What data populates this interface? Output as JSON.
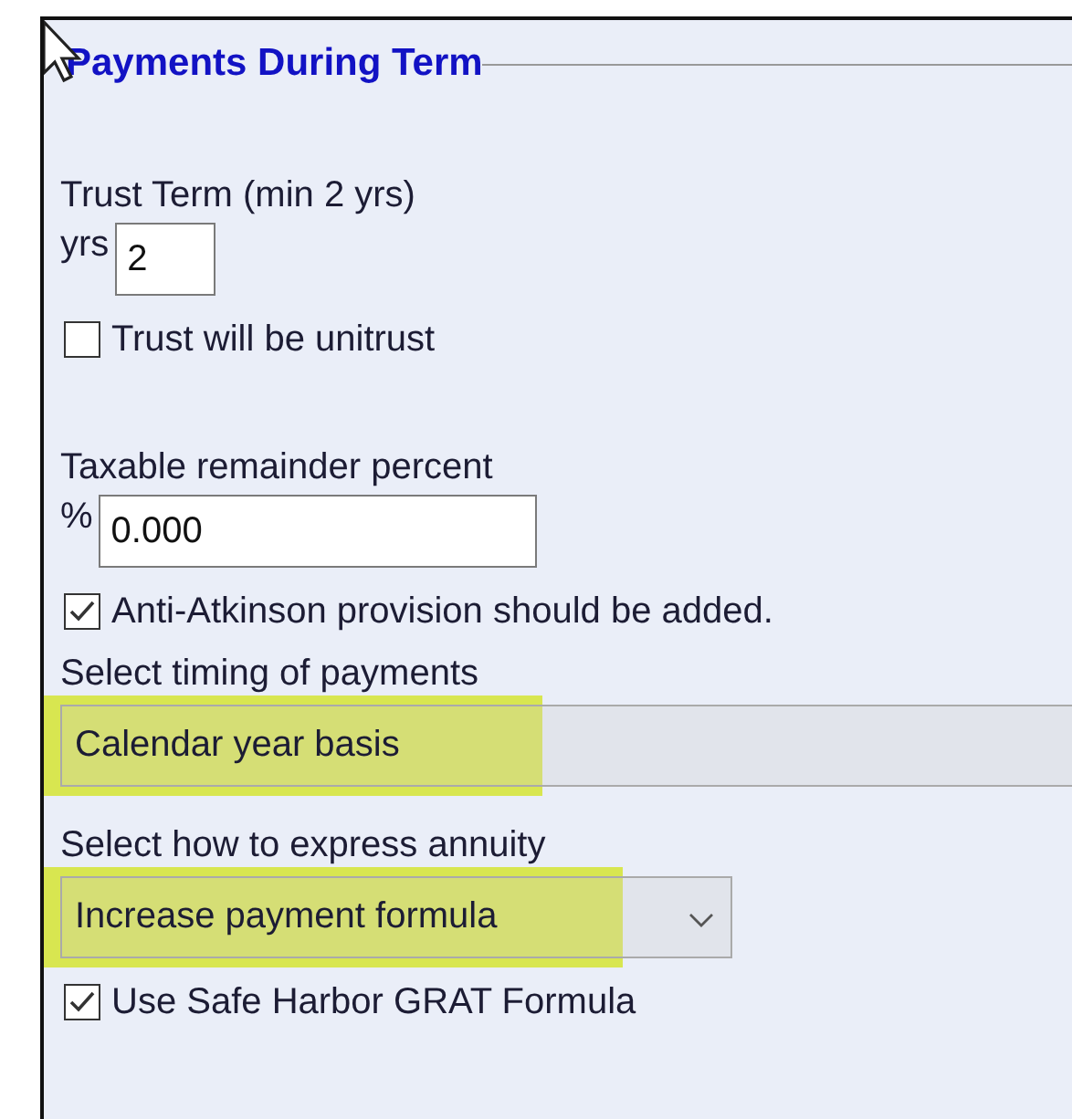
{
  "group": {
    "title": "Payments During Term"
  },
  "fields": [
    {
      "kind": "input",
      "label": "Trust Term (min 2 yrs)",
      "prefix": "yrs",
      "value": "2"
    },
    {
      "kind": "checkbox",
      "label": "Trust will be unitrust",
      "checked": false
    },
    {
      "kind": "input",
      "label": "Taxable remainder percent",
      "prefix": "%",
      "value": "0.000"
    },
    {
      "kind": "checkbox",
      "label": "Anti-Atkinson provision should be added.",
      "checked": true
    },
    {
      "kind": "dropdown",
      "label": "Select timing of payments",
      "value": "Calendar year basis",
      "highlighted": true
    },
    {
      "kind": "dropdown",
      "label": "Select how to express annuity",
      "value": "Increase payment formula",
      "highlighted": true
    },
    {
      "kind": "checkbox",
      "label": "Use Safe Harbor GRAT Formula",
      "checked": true
    }
  ]
}
